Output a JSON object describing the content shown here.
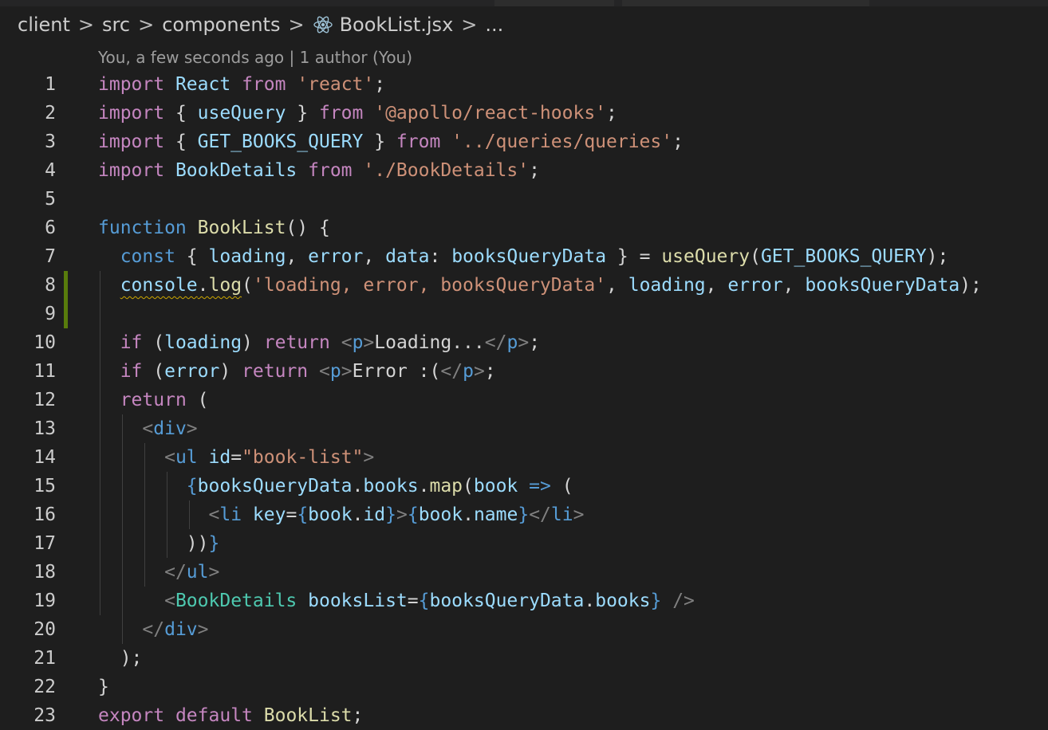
{
  "breadcrumb": {
    "items": [
      "client",
      "src",
      "components"
    ],
    "file": "BookList.jsx",
    "more": "...",
    "separator": ">",
    "file_icon": "react-icon"
  },
  "blame": {
    "text": "You, a few seconds ago | 1 author (You)"
  },
  "colors": {
    "background": "#1e1e1e",
    "keyword_control": "#c586c0",
    "keyword_storage": "#569cd6",
    "variable": "#9cdcfe",
    "string": "#ce9178",
    "function": "#dcdcaa",
    "component": "#4ec9b0",
    "modified_gutter": "#587c0c"
  },
  "editor": {
    "modified_lines": [
      8,
      9
    ],
    "warning_squiggle": "console.log",
    "lines": [
      {
        "n": "1",
        "tokens": [
          [
            "kw",
            "import"
          ],
          [
            "pun",
            " "
          ],
          [
            "var",
            "React"
          ],
          [
            "pun",
            " "
          ],
          [
            "kw",
            "from"
          ],
          [
            "pun",
            " "
          ],
          [
            "str",
            "'react'"
          ],
          [
            "pun",
            ";"
          ]
        ]
      },
      {
        "n": "2",
        "tokens": [
          [
            "kw",
            "import"
          ],
          [
            "pun",
            " { "
          ],
          [
            "var",
            "useQuery"
          ],
          [
            "pun",
            " } "
          ],
          [
            "kw",
            "from"
          ],
          [
            "pun",
            " "
          ],
          [
            "str",
            "'@apollo/react-hooks'"
          ],
          [
            "pun",
            ";"
          ]
        ]
      },
      {
        "n": "3",
        "tokens": [
          [
            "kw",
            "import"
          ],
          [
            "pun",
            " { "
          ],
          [
            "var",
            "GET_BOOKS_QUERY"
          ],
          [
            "pun",
            " } "
          ],
          [
            "kw",
            "from"
          ],
          [
            "pun",
            " "
          ],
          [
            "str",
            "'../queries/queries'"
          ],
          [
            "pun",
            ";"
          ]
        ]
      },
      {
        "n": "4",
        "tokens": [
          [
            "kw",
            "import"
          ],
          [
            "pun",
            " "
          ],
          [
            "var",
            "BookDetails"
          ],
          [
            "pun",
            " "
          ],
          [
            "kw",
            "from"
          ],
          [
            "pun",
            " "
          ],
          [
            "str",
            "'./BookDetails'"
          ],
          [
            "pun",
            ";"
          ]
        ]
      },
      {
        "n": "5",
        "tokens": []
      },
      {
        "n": "6",
        "tokens": [
          [
            "sk",
            "function"
          ],
          [
            "pun",
            " "
          ],
          [
            "fn",
            "BookList"
          ],
          [
            "pun",
            "() {"
          ]
        ]
      },
      {
        "n": "7",
        "tokens": [
          [
            "pun",
            "  "
          ],
          [
            "sk",
            "const"
          ],
          [
            "pun",
            " { "
          ],
          [
            "var",
            "loading"
          ],
          [
            "pun",
            ", "
          ],
          [
            "var",
            "error"
          ],
          [
            "pun",
            ", "
          ],
          [
            "var",
            "data"
          ],
          [
            "pun",
            ": "
          ],
          [
            "var",
            "booksQueryData"
          ],
          [
            "pun",
            " } = "
          ],
          [
            "fn",
            "useQuery"
          ],
          [
            "pun",
            "("
          ],
          [
            "var",
            "GET_BOOKS_QUERY"
          ],
          [
            "pun",
            ");"
          ]
        ]
      },
      {
        "n": "8",
        "tokens": [
          [
            "pun",
            "  "
          ],
          [
            "var squig",
            "console"
          ],
          [
            "pun squig",
            "."
          ],
          [
            "fn squig",
            "log"
          ],
          [
            "pun",
            "("
          ],
          [
            "str",
            "'loading, error, booksQueryData'"
          ],
          [
            "pun",
            ", "
          ],
          [
            "var",
            "loading"
          ],
          [
            "pun",
            ", "
          ],
          [
            "var",
            "error"
          ],
          [
            "pun",
            ", "
          ],
          [
            "var",
            "booksQueryData"
          ],
          [
            "pun",
            ");"
          ]
        ]
      },
      {
        "n": "9",
        "tokens": []
      },
      {
        "n": "10",
        "tokens": [
          [
            "pun",
            "  "
          ],
          [
            "kw",
            "if"
          ],
          [
            "pun",
            " ("
          ],
          [
            "var",
            "loading"
          ],
          [
            "pun",
            ") "
          ],
          [
            "kw",
            "return"
          ],
          [
            "pun",
            " "
          ],
          [
            "ang",
            "<"
          ],
          [
            "tag",
            "p"
          ],
          [
            "ang",
            ">"
          ],
          [
            "txt",
            "Loading..."
          ],
          [
            "ang",
            "</"
          ],
          [
            "tag",
            "p"
          ],
          [
            "ang",
            ">"
          ],
          [
            "pun",
            ";"
          ]
        ]
      },
      {
        "n": "11",
        "tokens": [
          [
            "pun",
            "  "
          ],
          [
            "kw",
            "if"
          ],
          [
            "pun",
            " ("
          ],
          [
            "var",
            "error"
          ],
          [
            "pun",
            ") "
          ],
          [
            "kw",
            "return"
          ],
          [
            "pun",
            " "
          ],
          [
            "ang",
            "<"
          ],
          [
            "tag",
            "p"
          ],
          [
            "ang",
            ">"
          ],
          [
            "txt",
            "Error :("
          ],
          [
            "ang",
            "</"
          ],
          [
            "tag",
            "p"
          ],
          [
            "ang",
            ">"
          ],
          [
            "pun",
            ";"
          ]
        ]
      },
      {
        "n": "12",
        "tokens": [
          [
            "pun",
            "  "
          ],
          [
            "kw",
            "return"
          ],
          [
            "pun",
            " ("
          ]
        ]
      },
      {
        "n": "13",
        "tokens": [
          [
            "pun",
            "    "
          ],
          [
            "ang",
            "<"
          ],
          [
            "tag",
            "div"
          ],
          [
            "ang",
            ">"
          ]
        ]
      },
      {
        "n": "14",
        "tokens": [
          [
            "pun",
            "      "
          ],
          [
            "ang",
            "<"
          ],
          [
            "tag",
            "ul"
          ],
          [
            "pun",
            " "
          ],
          [
            "var",
            "id"
          ],
          [
            "pun",
            "="
          ],
          [
            "str",
            "\"book-list\""
          ],
          [
            "ang",
            ">"
          ]
        ]
      },
      {
        "n": "15",
        "tokens": [
          [
            "pun",
            "        "
          ],
          [
            "brc",
            "{"
          ],
          [
            "var",
            "booksQueryData"
          ],
          [
            "pun",
            "."
          ],
          [
            "var",
            "books"
          ],
          [
            "pun",
            "."
          ],
          [
            "fn",
            "map"
          ],
          [
            "pun",
            "("
          ],
          [
            "var",
            "book"
          ],
          [
            "pun",
            " "
          ],
          [
            "sk",
            "=>"
          ],
          [
            "pun",
            " ("
          ]
        ]
      },
      {
        "n": "16",
        "tokens": [
          [
            "pun",
            "          "
          ],
          [
            "ang",
            "<"
          ],
          [
            "tag",
            "li"
          ],
          [
            "pun",
            " "
          ],
          [
            "var",
            "key"
          ],
          [
            "pun",
            "="
          ],
          [
            "brc",
            "{"
          ],
          [
            "var",
            "book"
          ],
          [
            "pun",
            "."
          ],
          [
            "var",
            "id"
          ],
          [
            "brc",
            "}"
          ],
          [
            "ang",
            ">"
          ],
          [
            "brc",
            "{"
          ],
          [
            "var",
            "book"
          ],
          [
            "pun",
            "."
          ],
          [
            "var",
            "name"
          ],
          [
            "brc",
            "}"
          ],
          [
            "ang",
            "</"
          ],
          [
            "tag",
            "li"
          ],
          [
            "ang",
            ">"
          ]
        ]
      },
      {
        "n": "17",
        "tokens": [
          [
            "pun",
            "        ))"
          ],
          [
            "brc",
            "}"
          ]
        ]
      },
      {
        "n": "18",
        "tokens": [
          [
            "pun",
            "      "
          ],
          [
            "ang",
            "</"
          ],
          [
            "tag",
            "ul"
          ],
          [
            "ang",
            ">"
          ]
        ]
      },
      {
        "n": "19",
        "tokens": [
          [
            "pun",
            "      "
          ],
          [
            "ang",
            "<"
          ],
          [
            "comp",
            "BookDetails"
          ],
          [
            "pun",
            " "
          ],
          [
            "var",
            "booksList"
          ],
          [
            "pun",
            "="
          ],
          [
            "brc",
            "{"
          ],
          [
            "var",
            "booksQueryData"
          ],
          [
            "pun",
            "."
          ],
          [
            "var",
            "books"
          ],
          [
            "brc",
            "}"
          ],
          [
            "pun",
            " "
          ],
          [
            "ang",
            "/>"
          ]
        ]
      },
      {
        "n": "20",
        "tokens": [
          [
            "pun",
            "    "
          ],
          [
            "ang",
            "</"
          ],
          [
            "tag",
            "div"
          ],
          [
            "ang",
            ">"
          ]
        ]
      },
      {
        "n": "21",
        "tokens": [
          [
            "pun",
            "  );"
          ]
        ]
      },
      {
        "n": "22",
        "tokens": [
          [
            "pun",
            "}"
          ]
        ]
      },
      {
        "n": "23",
        "tokens": [
          [
            "kw",
            "export"
          ],
          [
            "pun",
            " "
          ],
          [
            "kw",
            "default"
          ],
          [
            "pun",
            " "
          ],
          [
            "fn",
            "BookList"
          ],
          [
            "pun",
            ";"
          ]
        ]
      }
    ]
  }
}
